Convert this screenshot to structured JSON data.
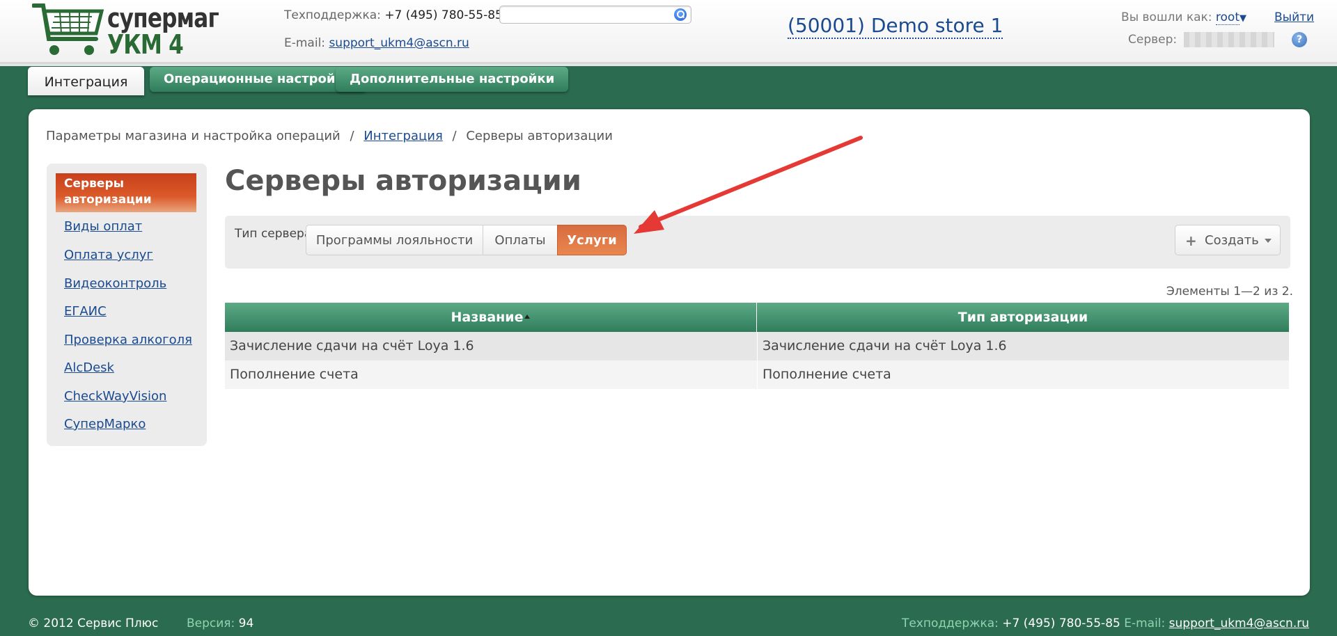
{
  "header": {
    "logo_line1": "супермаг",
    "logo_line2": "УКМ 4",
    "support_label": "Техподдержка:",
    "support_phone": "+7 (495) 780-55-85",
    "email_label": "E-mail:",
    "email": "support_ukm4@ascn.ru",
    "search_value": "",
    "store": "(50001) Demo store 1",
    "login_label": "Вы вошли как:",
    "user": "root",
    "logout": "Выйти",
    "server_label": "Сервер:",
    "help": "?"
  },
  "tabs": [
    {
      "label": "Интеграция",
      "active": true
    },
    {
      "label": "Операционные настройки",
      "active": false
    },
    {
      "label": "Дополнительные настройки",
      "active": false
    }
  ],
  "breadcrumb": {
    "root": "Параметры магазина и настройка операций",
    "sep": "/",
    "link": "Интеграция",
    "current": "Серверы авторизации"
  },
  "sidebar": {
    "active": "Серверы авторизации",
    "items": [
      "Виды оплат",
      "Оплата услуг",
      "Видеоконтроль",
      "ЕГАИС",
      "Проверка алкоголя",
      "AlcDesk",
      "CheckWayVision",
      "СуперМарко"
    ]
  },
  "main": {
    "title": "Серверы авторизации",
    "server_type_label": "Тип сервера:",
    "segments": [
      "Программы лояльности",
      "Оплаты",
      "Услуги"
    ],
    "active_segment": "Услуги",
    "create": "Создать",
    "count": "Элементы 1—2 из 2."
  },
  "table": {
    "columns": [
      "Название",
      "Тип авторизации"
    ],
    "rows": [
      [
        "Зачисление сдачи на счёт Loya 1.6",
        "Зачисление сдачи на счёт Loya 1.6"
      ],
      [
        "Пополнение счета",
        "Пополнение счета"
      ]
    ]
  },
  "footer": {
    "copyright": "© 2012 Сервис Плюс",
    "version_label": "Версия:",
    "version": "94",
    "support_label": "Техподдержка:",
    "support_phone": "+7 (495) 780-55-85",
    "email_label": "E-mail:",
    "email": "support_ukm4@ascn.ru"
  },
  "colors": {
    "background": "#2b6b4f",
    "accent_orange": "#db5a2a",
    "header_green": "#2f7d5b",
    "link": "#1a4a90",
    "annotation_arrow": "#e53935"
  }
}
